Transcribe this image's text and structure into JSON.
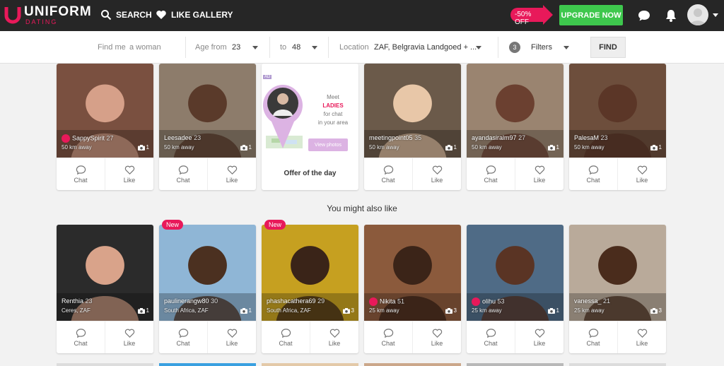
{
  "header": {
    "brand": "UNIFORM",
    "brand_sub": "DATING",
    "search_label": "SEARCH",
    "gallery_label": "LIKE GALLERY",
    "discount": "-50% OFF",
    "upgrade_label": "UPGRADE NOW",
    "colors": {
      "accent": "#e8195a",
      "upgrade": "#3ec74d",
      "bar": "#262626"
    }
  },
  "filters": {
    "find_me_label": "Find me",
    "find_me_value": "a woman",
    "age_from_label": "Age from",
    "age_from_value": "23",
    "age_to_label": "to",
    "age_to_value": "48",
    "location_label": "Location",
    "location_value": "ZAF, Belgravia Landgoed + ...",
    "filters_count": "3",
    "filters_label": "Filters",
    "find_button": "FIND"
  },
  "actions": {
    "chat": "Chat",
    "like": "Like"
  },
  "offer": {
    "line1": "Meet",
    "line2": "LADIES",
    "line3": "for chat",
    "line4": "in your area",
    "button": "View photos",
    "footer": "Offer of the day",
    "ad": "AD"
  },
  "section_title": "You might also like",
  "row1": [
    {
      "name": "SappySpirit",
      "age": "27",
      "sub": "50 km away",
      "photos": "1",
      "premium": true
    },
    {
      "name": "Leesadee",
      "age": "23",
      "sub": "50 km away",
      "photos": "1",
      "premium": false
    },
    {
      "name": "meetingpoint05",
      "age": "35",
      "sub": "50 km away",
      "photos": "1",
      "premium": false
    },
    {
      "name": "ayandasiralm97",
      "age": "27",
      "sub": "50 km away",
      "photos": "1",
      "premium": false
    },
    {
      "name": "PalesaM",
      "age": "23",
      "sub": "50 km away",
      "photos": "1",
      "premium": false
    }
  ],
  "row2": [
    {
      "name": "Renthia",
      "age": "23",
      "sub": "Ceres, ZAF",
      "photos": "1",
      "premium": false,
      "badge": ""
    },
    {
      "name": "paulinerangw80",
      "age": "30",
      "sub": "South Africa, ZAF",
      "photos": "1",
      "premium": false,
      "badge": "New"
    },
    {
      "name": "phashacathera69",
      "age": "29",
      "sub": "South Africa, ZAF",
      "photos": "3",
      "premium": false,
      "badge": "New"
    },
    {
      "name": "Nikita",
      "age": "51",
      "sub": "25 km away",
      "photos": "3",
      "premium": true,
      "badge": ""
    },
    {
      "name": "olihu",
      "age": "53",
      "sub": "25 km away",
      "photos": "1",
      "premium": true,
      "badge": ""
    },
    {
      "name": "vanessa_",
      "age": "21",
      "sub": "25 km away",
      "photos": "3",
      "premium": false,
      "badge": ""
    }
  ]
}
